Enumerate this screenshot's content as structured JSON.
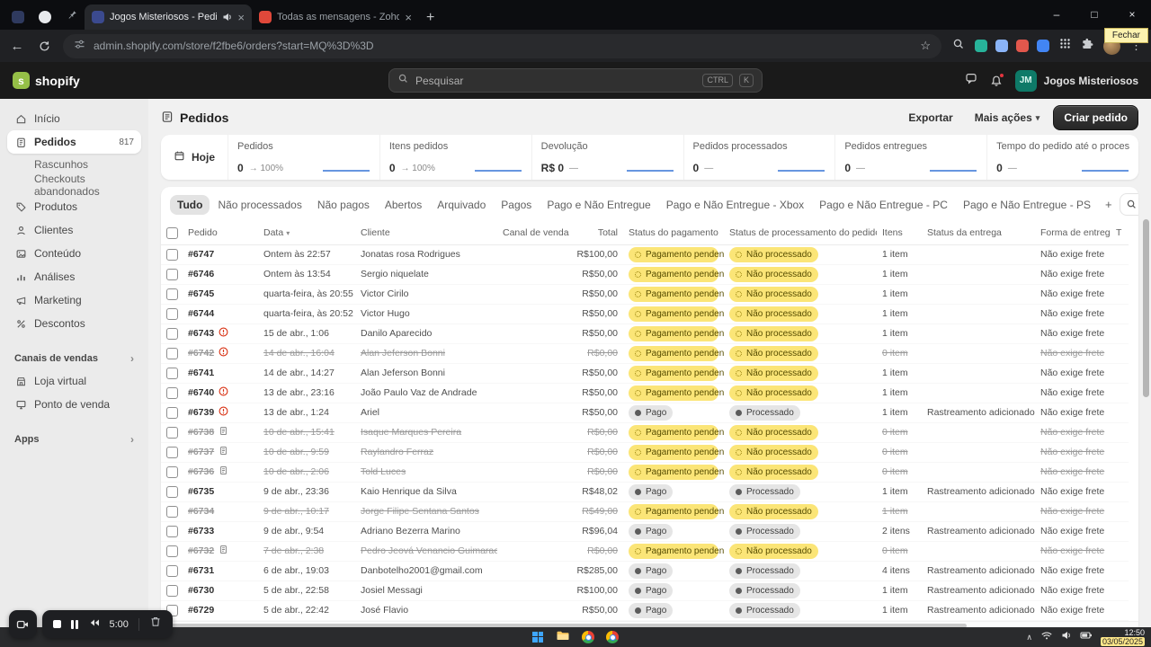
{
  "browser": {
    "tabs": [
      {
        "title": "Jogos Misteriosos - Pedido",
        "favicon_color": "#3b4a8f",
        "audio": true,
        "active": true
      },
      {
        "title": "Todas as mensagens - Zoho M",
        "favicon_color": "#e0483a",
        "audio": false,
        "active": false
      }
    ],
    "url": "admin.shopify.com/store/f2fbe6/orders?start=MQ%3D%3D",
    "close_tooltip": "Fechar",
    "toolbar_icons": [
      {
        "name": "extension-teal-icon",
        "color": "#27b39a"
      },
      {
        "name": "extension-blue-icon",
        "color": "#8ab4f8"
      },
      {
        "name": "extension-red-icon",
        "color": "#e2574c"
      },
      {
        "name": "extension-indigo-icon",
        "color": "#4285f4"
      }
    ]
  },
  "shopify_header": {
    "brand": "shopify",
    "search_placeholder": "Pesquisar",
    "kbd_ctrl": "CTRL",
    "kbd_k": "K",
    "account_initials": "JM",
    "account_name": "Jogos Misteriosos"
  },
  "sidebar": {
    "items": [
      {
        "label": "Início",
        "icon": "home"
      },
      {
        "label": "Pedidos",
        "icon": "orders",
        "badge": "817",
        "active": true
      },
      {
        "label": "Rascunhos",
        "sub": true
      },
      {
        "label": "Checkouts abandonados",
        "sub": true
      },
      {
        "label": "Produtos",
        "icon": "products"
      },
      {
        "label": "Clientes",
        "icon": "customers"
      },
      {
        "label": "Conteúdo",
        "icon": "content"
      },
      {
        "label": "Análises",
        "icon": "analytics"
      },
      {
        "label": "Marketing",
        "icon": "marketing"
      },
      {
        "label": "Descontos",
        "icon": "discounts"
      }
    ],
    "sections": [
      {
        "title": "Canais de vendas",
        "items": [
          {
            "label": "Loja virtual",
            "icon": "store"
          },
          {
            "label": "Ponto de venda",
            "icon": "pos"
          }
        ]
      },
      {
        "title": "Apps",
        "items": []
      }
    ]
  },
  "page": {
    "title": "Pedidos",
    "export_label": "Exportar",
    "more_actions_label": "Mais ações",
    "create_order_label": "Criar pedido"
  },
  "stats": {
    "period_label": "Hoje",
    "cards": [
      {
        "label": "Pedidos",
        "value": "0",
        "delta": "→ 100%"
      },
      {
        "label": "Itens pedidos",
        "value": "0",
        "delta": "→ 100%"
      },
      {
        "label": "Devolução",
        "value": "R$ 0",
        "delta": "—"
      },
      {
        "label": "Pedidos processados",
        "value": "0",
        "delta": "—"
      },
      {
        "label": "Pedidos entregues",
        "value": "0",
        "delta": "—"
      },
      {
        "label": "Tempo do pedido até o process...",
        "value": "0",
        "delta": "—"
      }
    ]
  },
  "filters": {
    "tabs": [
      {
        "label": "Tudo",
        "active": true
      },
      {
        "label": "Não processados"
      },
      {
        "label": "Não pagos"
      },
      {
        "label": "Abertos"
      },
      {
        "label": "Arquivado"
      },
      {
        "label": "Pagos"
      },
      {
        "label": "Pago e Não Entregue"
      },
      {
        "label": "Pago e Não Entregue - Xbox"
      },
      {
        "label": "Pago e Não Entregue - PC"
      },
      {
        "label": "Pago e Não Entregue - PS"
      }
    ],
    "add_label": "+"
  },
  "table": {
    "columns": [
      "Pedido",
      "Data",
      "Cliente",
      "Canal de vendas",
      "Total",
      "Status do pagamento",
      "Status de processamento do pedido",
      "Itens",
      "Status da entrega",
      "Forma de entrega",
      "T"
    ],
    "badges": {
      "pending": "Pagamento pendente",
      "paid": "Pago",
      "unprocessed": "Não processado",
      "processed": "Processado"
    },
    "rows": [
      {
        "id": "#6747",
        "icon": "",
        "struck": false,
        "date": "Ontem às 22:57",
        "customer": "Jonatas rosa Rodrigues",
        "channel": "",
        "total": "R$100,00",
        "payment": "pending",
        "processing": "unprocessed",
        "items": "1 item",
        "delivery": "",
        "shipping": "Não exige frete"
      },
      {
        "id": "#6746",
        "icon": "",
        "struck": false,
        "date": "Ontem às 13:54",
        "customer": "Sergio niquelate",
        "channel": "",
        "total": "R$50,00",
        "payment": "pending",
        "processing": "unprocessed",
        "items": "1 item",
        "delivery": "",
        "shipping": "Não exige frete"
      },
      {
        "id": "#6745",
        "icon": "",
        "struck": false,
        "date": "quarta-feira, às 20:55",
        "customer": "Victor Cirilo",
        "channel": "",
        "total": "R$50,00",
        "payment": "pending",
        "processing": "unprocessed",
        "items": "1 item",
        "delivery": "",
        "shipping": "Não exige frete"
      },
      {
        "id": "#6744",
        "icon": "",
        "struck": false,
        "date": "quarta-feira, às 20:52",
        "customer": "Victor Hugo",
        "channel": "",
        "total": "R$50,00",
        "payment": "pending",
        "processing": "unprocessed",
        "items": "1 item",
        "delivery": "",
        "shipping": "Não exige frete"
      },
      {
        "id": "#6743",
        "icon": "warning",
        "struck": false,
        "date": "15 de abr., 1:06",
        "customer": "Danilo Aparecido",
        "channel": "",
        "total": "R$50,00",
        "payment": "pending",
        "processing": "unprocessed",
        "items": "1 item",
        "delivery": "",
        "shipping": "Não exige frete"
      },
      {
        "id": "#6742",
        "icon": "warning",
        "struck": true,
        "date": "14 de abr., 16:04",
        "customer": "Alan Jeferson Bonni",
        "channel": "",
        "total": "R$0,00",
        "payment": "pending",
        "processing": "unprocessed",
        "items": "0 item",
        "delivery": "",
        "shipping": "Não exige frete"
      },
      {
        "id": "#6741",
        "icon": "",
        "struck": false,
        "date": "14 de abr., 14:27",
        "customer": "Alan Jeferson Bonni",
        "channel": "",
        "total": "R$50,00",
        "payment": "pending",
        "processing": "unprocessed",
        "items": "1 item",
        "delivery": "",
        "shipping": "Não exige frete"
      },
      {
        "id": "#6740",
        "icon": "warning",
        "struck": false,
        "date": "13 de abr., 23:16",
        "customer": "João Paulo Vaz de Andrade",
        "channel": "",
        "total": "R$50,00",
        "payment": "pending",
        "processing": "unprocessed",
        "items": "1 item",
        "delivery": "",
        "shipping": "Não exige frete"
      },
      {
        "id": "#6739",
        "icon": "warning",
        "struck": false,
        "date": "13 de abr., 1:24",
        "customer": "Ariel",
        "channel": "",
        "total": "R$50,00",
        "payment": "paid",
        "processing": "processed",
        "items": "1 item",
        "delivery": "Rastreamento adicionado",
        "shipping": "Não exige frete"
      },
      {
        "id": "#6738",
        "icon": "doc",
        "struck": true,
        "date": "10 de abr., 15:41",
        "customer": "Isaque Marques Pereira",
        "channel": "",
        "total": "R$0,00",
        "payment": "pending",
        "processing": "unprocessed",
        "items": "0 item",
        "delivery": "",
        "shipping": "Não exige frete"
      },
      {
        "id": "#6737",
        "icon": "doc",
        "struck": true,
        "date": "10 de abr., 9:59",
        "customer": "Raylandro Ferraz",
        "channel": "",
        "total": "R$0,00",
        "payment": "pending",
        "processing": "unprocessed",
        "items": "0 item",
        "delivery": "",
        "shipping": "Não exige frete"
      },
      {
        "id": "#6736",
        "icon": "doc",
        "struck": true,
        "date": "10 de abr., 2:06",
        "customer": "Told Luces",
        "channel": "",
        "total": "R$0,00",
        "payment": "pending",
        "processing": "unprocessed",
        "items": "0 item",
        "delivery": "",
        "shipping": "Não exige frete"
      },
      {
        "id": "#6735",
        "icon": "",
        "struck": false,
        "date": "9 de abr., 23:36",
        "customer": "Kaio Henrique da Silva",
        "channel": "",
        "total": "R$48,02",
        "payment": "paid",
        "processing": "processed",
        "items": "1 item",
        "delivery": "Rastreamento adicionado",
        "shipping": "Não exige frete"
      },
      {
        "id": "#6734",
        "icon": "",
        "struck": true,
        "date": "9 de abr., 10:17",
        "customer": "Jorge Filipe Sentana Santos",
        "channel": "",
        "total": "R$49,00",
        "payment": "pending",
        "processing": "unprocessed",
        "items": "1 item",
        "delivery": "",
        "shipping": "Não exige frete"
      },
      {
        "id": "#6733",
        "icon": "",
        "struck": false,
        "date": "9 de abr., 9:54",
        "customer": "Adriano Bezerra Marino",
        "channel": "",
        "total": "R$96,04",
        "payment": "paid",
        "processing": "processed",
        "items": "2 itens",
        "delivery": "Rastreamento adicionado",
        "shipping": "Não exige frete"
      },
      {
        "id": "#6732",
        "icon": "doc",
        "struck": true,
        "date": "7 de abr., 2:38",
        "customer": "Pedro Jeová Venancio Guimaraes",
        "channel": "",
        "total": "R$0,00",
        "payment": "pending",
        "processing": "unprocessed",
        "items": "0 item",
        "delivery": "",
        "shipping": "Não exige frete"
      },
      {
        "id": "#6731",
        "icon": "",
        "struck": false,
        "date": "6 de abr., 19:03",
        "customer": "Danbotelho2001@gmail.com",
        "channel": "",
        "total": "R$285,00",
        "payment": "paid",
        "processing": "processed",
        "items": "4 itens",
        "delivery": "Rastreamento adicionado",
        "shipping": "Não exige frete"
      },
      {
        "id": "#6730",
        "icon": "",
        "struck": false,
        "date": "5 de abr., 22:58",
        "customer": "Josiel Messagi",
        "channel": "",
        "total": "R$100,00",
        "payment": "paid",
        "processing": "processed",
        "items": "1 item",
        "delivery": "Rastreamento adicionado",
        "shipping": "Não exige frete"
      },
      {
        "id": "#6729",
        "icon": "",
        "struck": false,
        "date": "5 de abr., 22:42",
        "customer": "José Flavio",
        "channel": "",
        "total": "R$50,00",
        "payment": "paid",
        "processing": "processed",
        "items": "1 item",
        "delivery": "Rastreamento adicionado",
        "shipping": "Não exige frete"
      }
    ]
  },
  "recorder": {
    "time": "5:00"
  },
  "taskbar": {
    "time": "12:50",
    "date": "03/05/2025"
  },
  "colors": {
    "shopify_green": "#95bf47",
    "badge_yellow": "#fbe577",
    "badge_gray": "#e5e5e5",
    "primary_button": "#2b2b2b",
    "sparkline_blue": "#3574d6",
    "avatar_teal": "#0e7a68",
    "highlight_yellow": "#ffe88a"
  }
}
